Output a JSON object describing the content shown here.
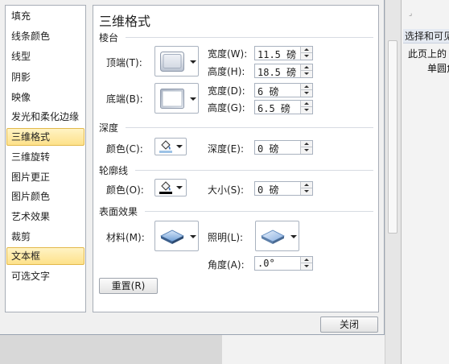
{
  "nav": {
    "items": [
      {
        "label": "填充"
      },
      {
        "label": "线条颜色"
      },
      {
        "label": "线型"
      },
      {
        "label": "阴影"
      },
      {
        "label": "映像"
      },
      {
        "label": "发光和柔化边缘"
      },
      {
        "label": "三维格式",
        "selected": true
      },
      {
        "label": "三维旋转"
      },
      {
        "label": "图片更正"
      },
      {
        "label": "图片颜色"
      },
      {
        "label": "艺术效果"
      },
      {
        "label": "裁剪"
      },
      {
        "label": "文本框",
        "highlighted": true
      },
      {
        "label": "可选文字"
      }
    ]
  },
  "content": {
    "title": "三维格式",
    "bevel": {
      "section_label": "棱台",
      "top_label": "顶端(T):",
      "bottom_label": "底端(B):",
      "top_width_label": "宽度(W):",
      "top_width_value": "11.5 磅",
      "top_height_label": "高度(H):",
      "top_height_value": "18.5 磅",
      "bottom_width_label": "宽度(D):",
      "bottom_width_value": "6 磅",
      "bottom_height_label": "高度(G):",
      "bottom_height_value": "6.5 磅",
      "top_icon": "bevel-circle-icon",
      "bottom_icon": "bevel-angle-icon"
    },
    "depth": {
      "section_label": "深度",
      "color_label": "颜色(C):",
      "depth_label": "深度(E):",
      "depth_value": "0 磅",
      "color_icon": "paint-bucket-icon"
    },
    "contour": {
      "section_label": "轮廓线",
      "color_label": "颜色(O):",
      "size_label": "大小(S):",
      "size_value": "0 磅",
      "color_icon": "paint-bucket-icon",
      "swatch_color": "#000000"
    },
    "surface": {
      "section_label": "表面效果",
      "material_label": "材料(M):",
      "lighting_label": "照明(L):",
      "angle_label": "角度(A):",
      "angle_value": ".0°",
      "material_icon": "material-plastic-icon",
      "lighting_icon": "lighting-balanced-icon"
    },
    "reset_label": "重置(R)"
  },
  "footer": {
    "close_label": "关闭"
  },
  "background": {
    "pane_title": "选择和可见",
    "pane_line1": "此页上的",
    "pane_line2": "单圆角"
  },
  "colors": {
    "selected_bg": "#fde18a",
    "selected_border": "#e3b94b",
    "panel_border": "#a7adb6"
  }
}
